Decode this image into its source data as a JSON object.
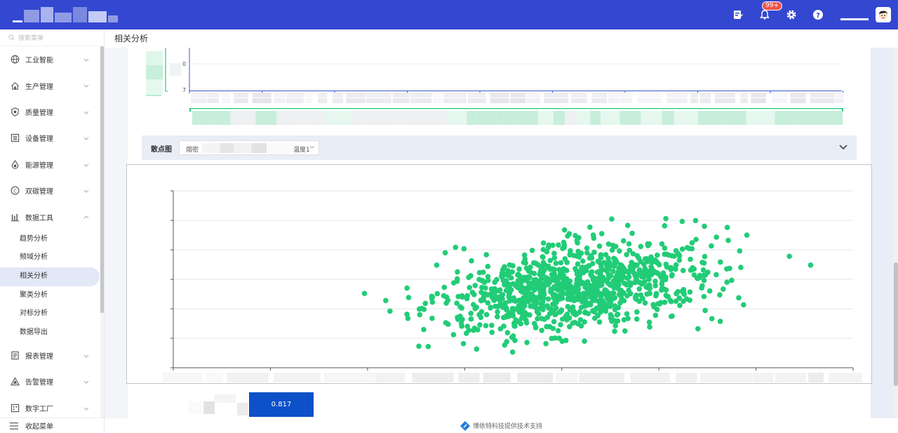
{
  "header": {
    "badge": "99+",
    "icons": [
      "note-icon",
      "bell-icon",
      "gear-icon",
      "help-icon"
    ]
  },
  "sidebar": {
    "search_placeholder": "搜索菜单",
    "items": [
      {
        "label": "工业智能",
        "icon": "globe-icon"
      },
      {
        "label": "生产管理",
        "icon": "house-icon"
      },
      {
        "label": "质量管理",
        "icon": "shield-icon"
      },
      {
        "label": "设备管理",
        "icon": "device-icon"
      },
      {
        "label": "能源管理",
        "icon": "drop-icon"
      },
      {
        "label": "双碳管理",
        "icon": "carbon-icon"
      },
      {
        "label": "数据工具",
        "icon": "bar-chart-icon",
        "expanded": true
      }
    ],
    "sub_items": [
      {
        "label": "趋势分析"
      },
      {
        "label": "频域分析"
      },
      {
        "label": "相关分析",
        "active": true
      },
      {
        "label": "聚类分析"
      },
      {
        "label": "对标分析"
      },
      {
        "label": "数据导出"
      }
    ],
    "items_after": [
      {
        "label": "报表管理",
        "icon": "report-icon"
      },
      {
        "label": "告警管理",
        "icon": "warning-icon"
      },
      {
        "label": "数字工厂",
        "icon": "factory-icon"
      }
    ],
    "collapse_label": "收起菜单"
  },
  "breadcrumb": {
    "title": "相关分析"
  },
  "top_chart": {
    "tick_labels": [
      "0",
      "7"
    ]
  },
  "toolbar": {
    "label": "散点图",
    "select_prefix": "熔密",
    "select_suffix": "温度1"
  },
  "chart_data": {
    "type": "scatter",
    "title": "",
    "xlabel": "",
    "ylabel": "",
    "grid": true,
    "color": "#22cc77",
    "x_ticks_count": 7,
    "y_ticks_count": 6,
    "points": [
      [
        0.45,
        0.42
      ],
      [
        0.5,
        0.38
      ],
      [
        0.51,
        0.32
      ],
      [
        0.55,
        0.45
      ],
      [
        0.59,
        0.33
      ],
      [
        0.61,
        0.4
      ],
      [
        0.6,
        0.12
      ],
      [
        0.58,
        0.3
      ],
      [
        0.62,
        0.58
      ],
      [
        0.64,
        0.65
      ],
      [
        0.66,
        0.48
      ],
      [
        0.7,
        0.52
      ],
      [
        0.72,
        0.3
      ],
      [
        0.75,
        0.2
      ],
      [
        0.77,
        0.22
      ],
      [
        0.8,
        0.18
      ],
      [
        0.82,
        0.28
      ],
      [
        0.85,
        0.25
      ],
      [
        0.88,
        0.35
      ],
      [
        0.9,
        0.45
      ],
      [
        0.92,
        0.68
      ],
      [
        0.95,
        0.72
      ],
      [
        0.98,
        0.62
      ],
      [
        1.02,
        0.58
      ],
      [
        1.05,
        0.66
      ],
      [
        1.08,
        0.76
      ],
      [
        1.1,
        0.6
      ],
      [
        1.15,
        0.7
      ],
      [
        1.2,
        0.55
      ],
      [
        1.25,
        0.8
      ],
      [
        1.35,
        0.75
      ],
      [
        1.45,
        0.63
      ],
      [
        1.5,
        0.58
      ]
    ]
  },
  "coefficient": {
    "value": "0.817"
  },
  "footer": {
    "text": "博依特科技提供技术支持"
  }
}
